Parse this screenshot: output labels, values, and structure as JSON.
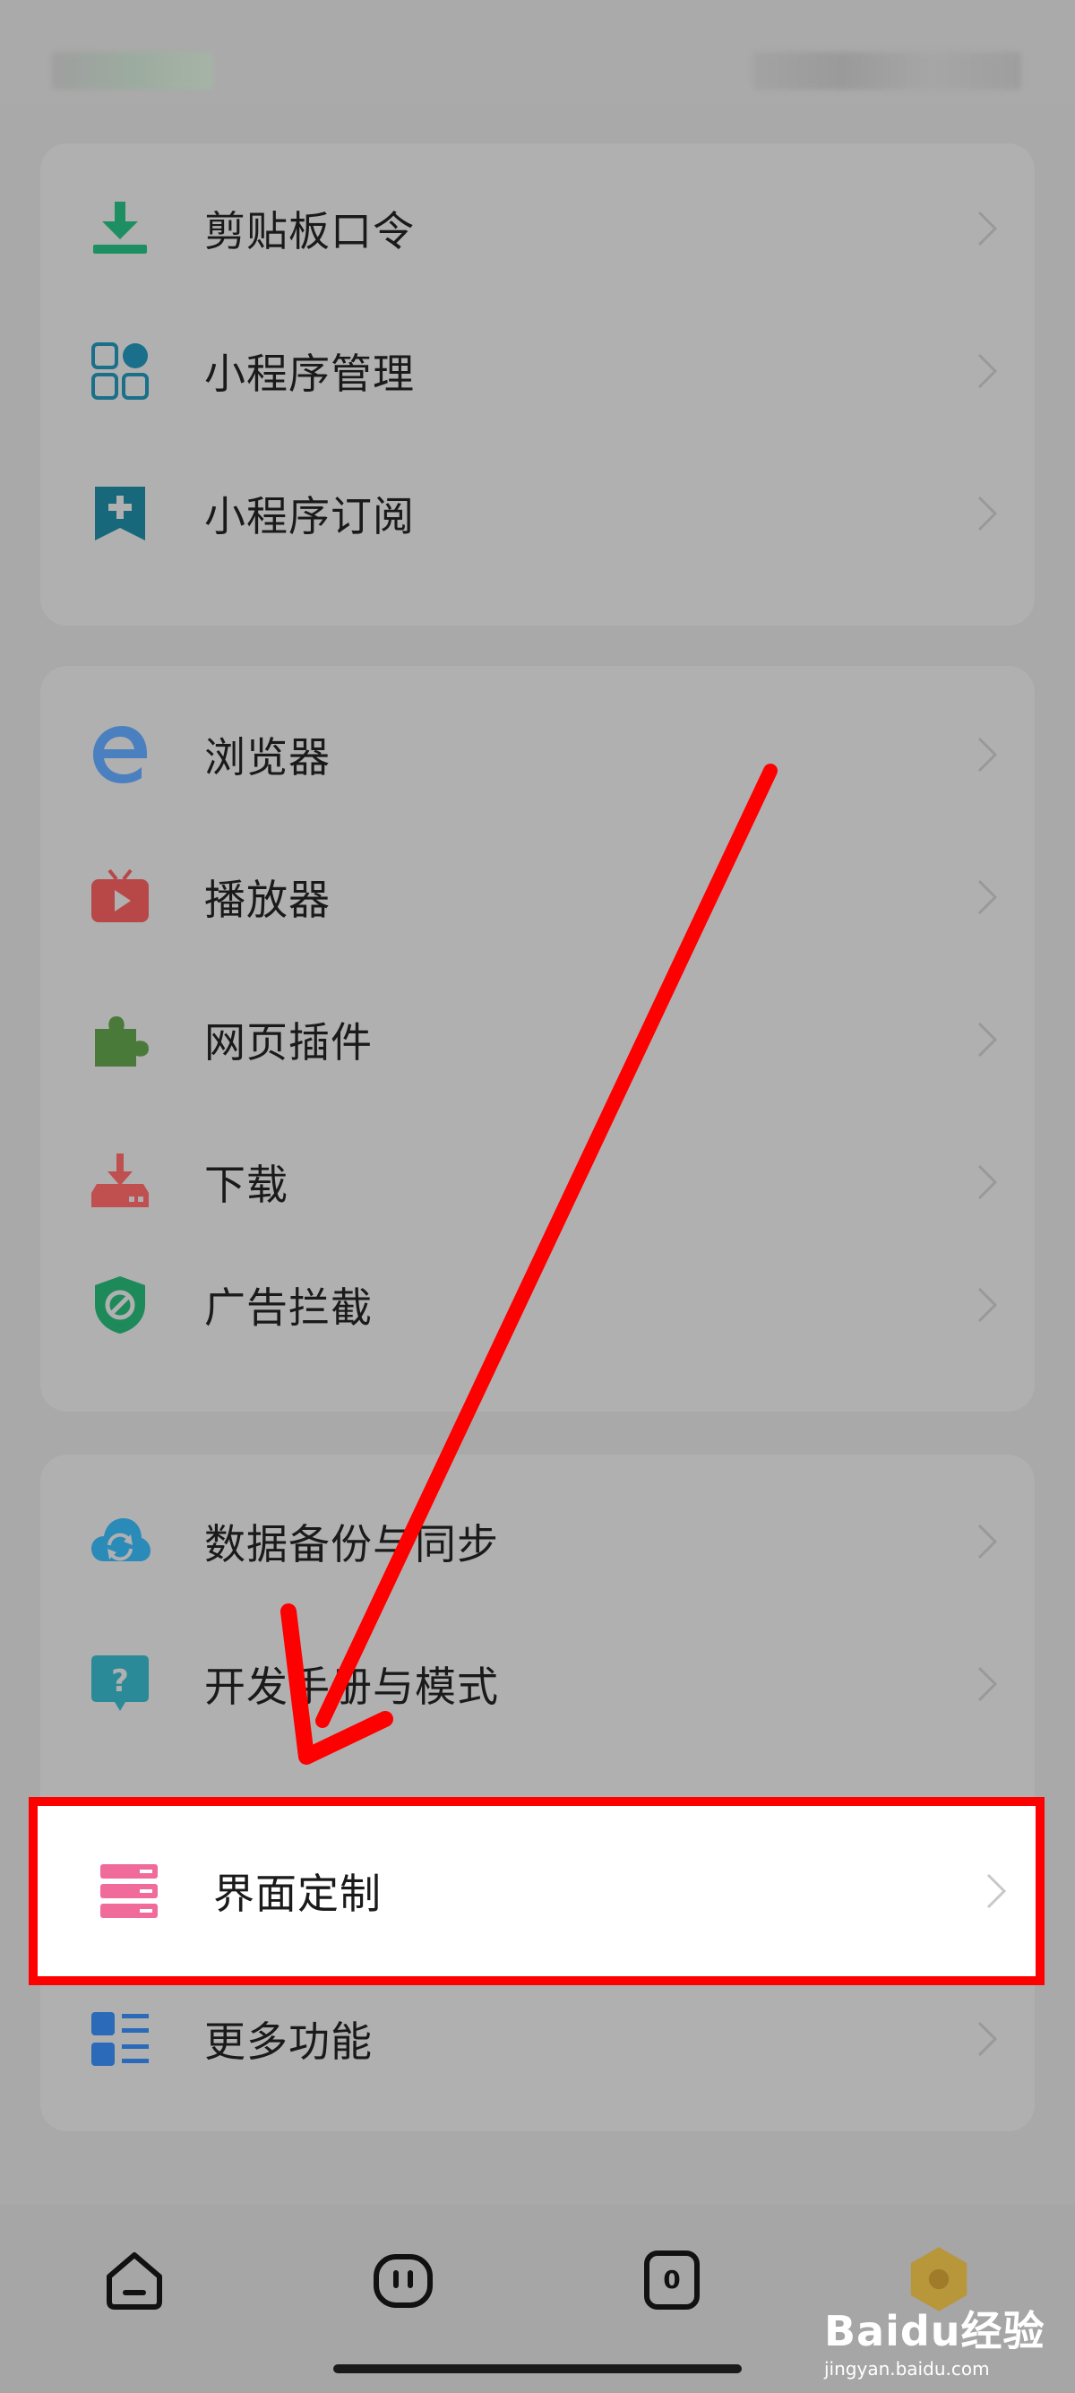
{
  "groups": [
    {
      "items": [
        {
          "label": "剪贴板口令",
          "icon": "download-tray-icon"
        },
        {
          "label": "小程序管理",
          "icon": "mini-program-grid-icon"
        },
        {
          "label": "小程序订阅",
          "icon": "bookmark-plus-icon"
        }
      ]
    },
    {
      "items": [
        {
          "label": "浏览器",
          "icon": "browser-e-icon"
        },
        {
          "label": "播放器",
          "icon": "tv-play-icon"
        },
        {
          "label": "网页插件",
          "icon": "puzzle-icon"
        },
        {
          "label": "下载",
          "icon": "download-device-icon"
        },
        {
          "label": "广告拦截",
          "icon": "shield-block-icon"
        }
      ]
    },
    {
      "items": [
        {
          "label": "数据备份与同步",
          "icon": "cloud-sync-icon"
        },
        {
          "label": "开发手册与模式",
          "icon": "help-bubble-icon"
        },
        {
          "label": "界面定制",
          "icon": "layout-customize-icon"
        },
        {
          "label": "更多功能",
          "icon": "more-list-icon"
        }
      ]
    }
  ],
  "bottom_nav": {
    "tabs": [
      {
        "icon": "home-icon"
      },
      {
        "icon": "face-icon"
      },
      {
        "icon": "tabs-count-icon",
        "count": "0"
      },
      {
        "icon": "profile-icon"
      }
    ]
  },
  "watermark": {
    "brand": "Baidu经验",
    "url": "jingyan.baidu.com"
  },
  "colors": {
    "highlight": "#ff0000",
    "background": "#a9a9a9",
    "card": "#b0b0b0"
  }
}
